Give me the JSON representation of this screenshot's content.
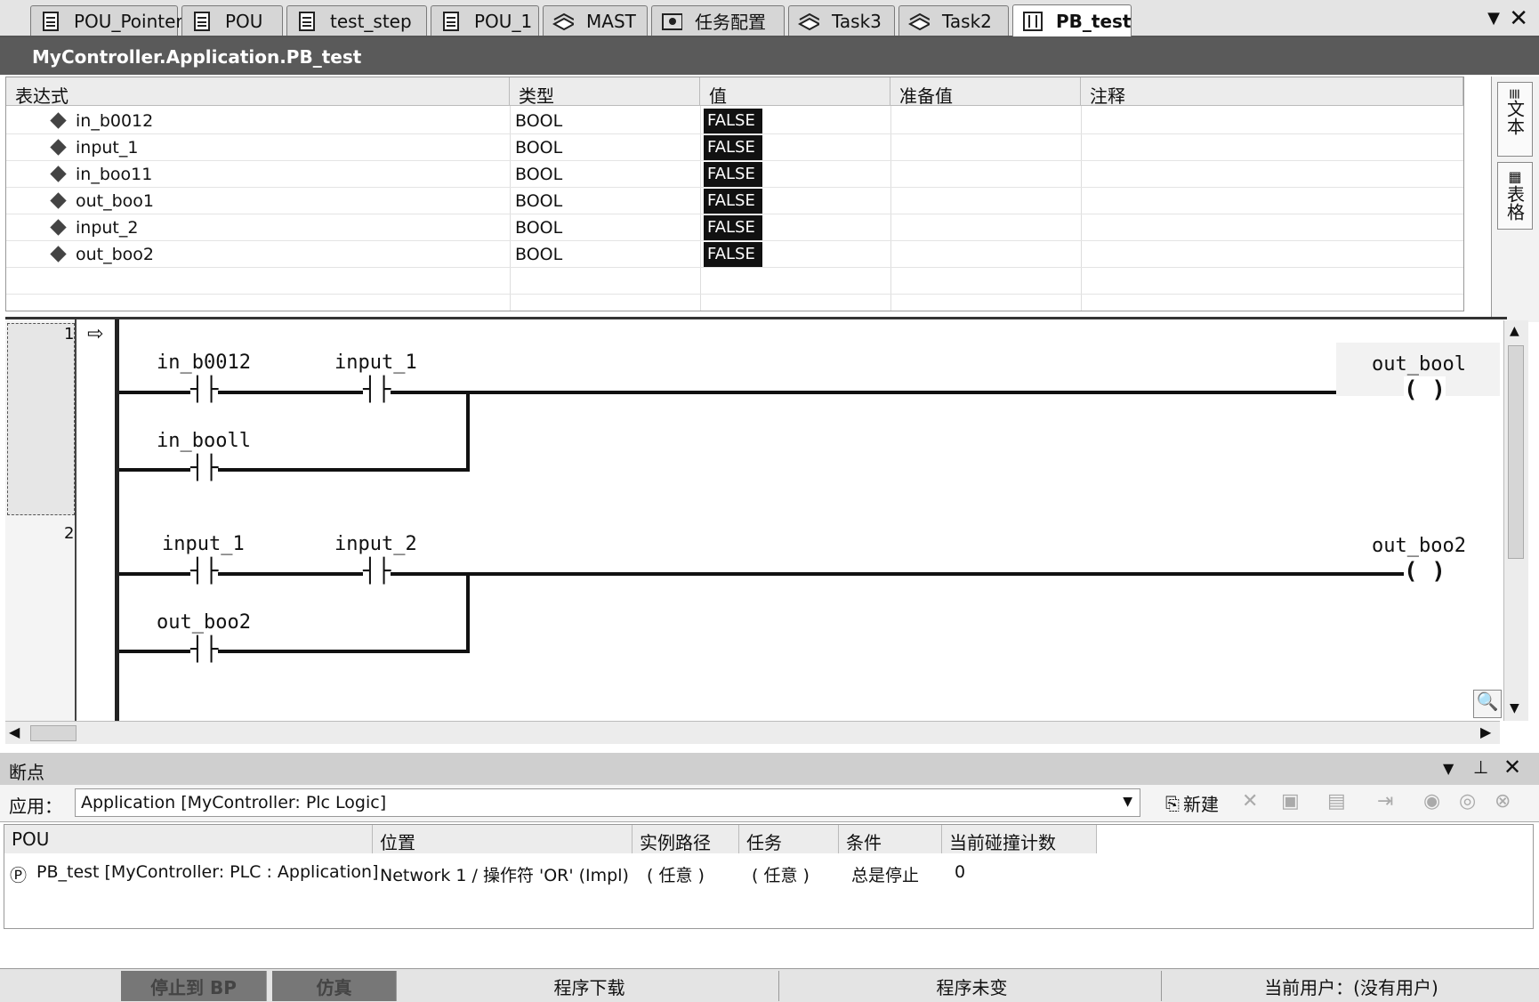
{
  "tabs": [
    {
      "label": "POU_Pointer",
      "icon": "document-icon",
      "active": false
    },
    {
      "label": "POU",
      "icon": "document-icon",
      "active": false
    },
    {
      "label": "test_step",
      "icon": "document-icon",
      "active": false
    },
    {
      "label": "POU_1",
      "icon": "document-icon",
      "active": false
    },
    {
      "label": "MAST",
      "icon": "task-icon",
      "active": false
    },
    {
      "label": "任务配置",
      "icon": "task-config-icon",
      "active": false
    },
    {
      "label": "Task3",
      "icon": "task-icon",
      "active": false
    },
    {
      "label": "Task2",
      "icon": "task-icon",
      "active": false
    },
    {
      "label": "PB_test",
      "icon": "ladder-icon",
      "active": true
    }
  ],
  "path": "MyController.Application.PB_test",
  "var_table": {
    "headers": [
      "表达式",
      "类型",
      "值",
      "准备值",
      "注释"
    ],
    "rows": [
      {
        "expr": "in_b0012",
        "type": "BOOL",
        "value": "FALSE"
      },
      {
        "expr": "input_1",
        "type": "BOOL",
        "value": "FALSE"
      },
      {
        "expr": "in_boo11",
        "type": "BOOL",
        "value": "FALSE"
      },
      {
        "expr": "out_boo1",
        "type": "BOOL",
        "value": "FALSE"
      },
      {
        "expr": "input_2",
        "type": "BOOL",
        "value": "FALSE"
      },
      {
        "expr": "out_boo2",
        "type": "BOOL",
        "value": "FALSE"
      }
    ]
  },
  "side_panel": {
    "text_label": "文本",
    "table_label": "表格"
  },
  "ladder": {
    "rung1": {
      "number": "1",
      "contacts": [
        "in_b0012",
        "input_1",
        "in_booll"
      ],
      "coil": "out_bool"
    },
    "rung2": {
      "number": "2",
      "contacts": [
        "input_1",
        "input_2",
        "out_boo2"
      ],
      "coil": "out_boo2"
    }
  },
  "breakpoints": {
    "title": "断点",
    "app_label": "应用：",
    "app_value": "Application [MyController: Plc Logic]",
    "new_label": "新建",
    "headers": [
      "POU",
      "位置",
      "实例路径",
      "任务",
      "条件",
      "当前碰撞计数"
    ],
    "row": {
      "pou": "PB_test [MyController: PLC : Application]",
      "location": "Network 1 / 操作符 'OR' (Impl)",
      "instance": "( 任意 )",
      "task": "( 任意 )",
      "condition": "总是停止",
      "hits": "0"
    }
  },
  "statusbar": {
    "stop_bp": "停止到 BP",
    "sim": "仿真",
    "download": "程序下载",
    "unchanged": "程序未变",
    "user": "当前用户：(没有用户)"
  }
}
